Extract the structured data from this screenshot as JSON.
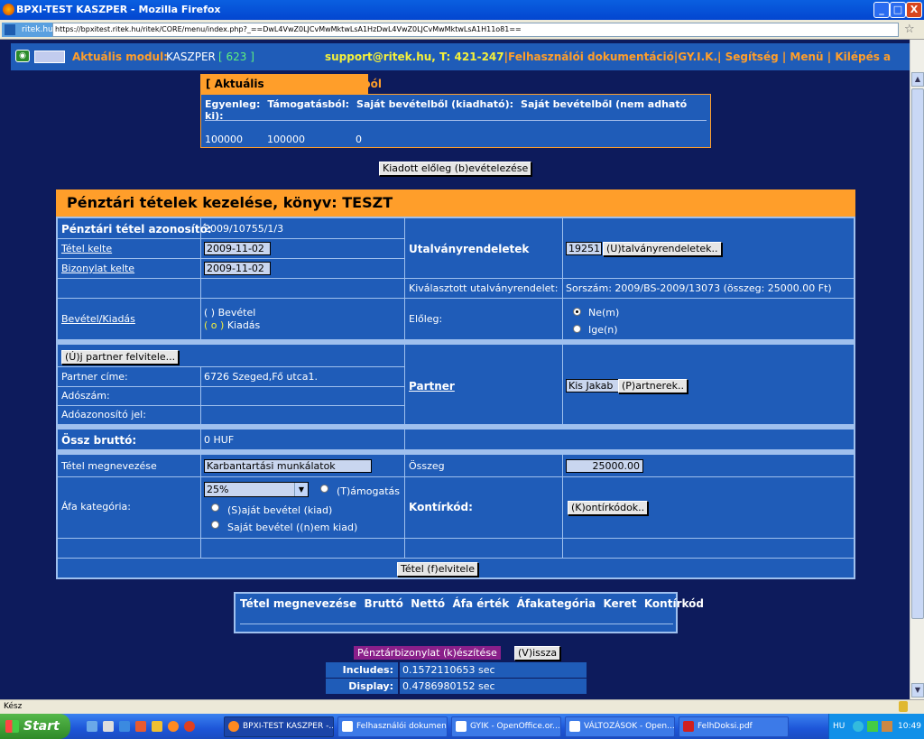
{
  "window": {
    "title": "BPXI-TEST KASZPER - Mozilla Firefox",
    "minimize": "_",
    "maximize": "□",
    "close": "X"
  },
  "urlbar": {
    "site": "ritek.hu",
    "url": "https://bpxitest.ritek.hu/ritek/CORE/menu/index.php?_==DwL4VwZ0LJCvMwMktwLsA1HzDwL4VwZ0LJCvMwMktwLsA1H11o81=="
  },
  "module": {
    "label": "Aktuális modul:",
    "name": "KASZPER",
    "number": "[ 623 ]",
    "links": [
      "support@ritek.hu, T: 421-247",
      "Felhasználói dokumentáció",
      "GY.I.K.",
      "Segítség",
      "Menü",
      "Kilépés a modulból"
    ]
  },
  "balance": {
    "title": "[ Aktuális pénztáregyenleg ]",
    "headers": [
      "Egyenleg:",
      "Támogatásból:",
      "Saját bevételből (kiadható):",
      "Saját bevételből (nem adható ki):"
    ],
    "values": [
      "100000",
      "100000",
      "0"
    ]
  },
  "advance_button": "Kiadott előleg (b)evételezése",
  "form": {
    "title": "Pénztári tételek kezelése, könyv: TESZT",
    "item_id_label": "Pénztári tétel azonosító:",
    "item_id": "2009/10755/1/3",
    "item_date_label": "Tétel kelte",
    "item_date": "2009-11-02",
    "doc_date_label": "Bizonylat kelte",
    "doc_date": "2009-11-02",
    "voucher_label": "Utalványrendeletek",
    "voucher_value": "19251",
    "voucher_button": "(U)talványrendeletek..",
    "selected_voucher_label": "Kiválasztott utalványrendelet:",
    "selected_voucher": "Sorszám: 2009/BS-2009/13073 (összeg: 25000.00 Ft)",
    "inout_label": "Bevétel/Kiadás",
    "income": "Bevétel",
    "expense": "Kiadás",
    "income_mark": "(   )",
    "expense_mark": "( o )",
    "advance_label": "Előleg:",
    "advance_no": "Ne(m)",
    "advance_yes": "Ige(n)",
    "new_partner_button": "(Ú)j partner felvitele...",
    "partner_addr_label": "Partner címe:",
    "partner_addr": "6726 Szeged,Fő utca1.",
    "tax_no_label": "Adószám:",
    "tax_id_label": "Adóazonosító jel:",
    "partner_label": "Partner",
    "partner_name": "Kis Jakab",
    "partner_button": "(P)artnerek..",
    "gross_label": "Össz bruttó:",
    "gross_value": "0 HUF",
    "item_name_label": "Tétel megnevezése",
    "item_name": "Karbantartási munkálatok",
    "amount_label": "Összeg",
    "amount": "25000.00",
    "vat_label": "Áfa kategória:",
    "vat_value": "25%",
    "support": "(T)ámogatás",
    "own_income": "(S)aját bevétel (kiad)",
    "own_income_no": "Saját bevétel ((n)em kiad)",
    "contir_label": "Kontírkód:",
    "contir_button": "(K)ontírkódok..",
    "submit_button": "Tétel (f)elvitele"
  },
  "summary": {
    "headers": [
      "Tétel megnevezése",
      "Bruttó",
      "Nettó",
      "Áfa érték",
      "Áfakategória",
      "Keret",
      "Kontírkód"
    ]
  },
  "print_button": "Pénztárbizonylat (k)észítése",
  "back_button": "(V)issza",
  "stats": [
    {
      "k": "Includes:",
      "v": "0.1572110653 sec"
    },
    {
      "k": "Display:",
      "v": "0.4786980152 sec"
    }
  ],
  "statusbar": "Kész",
  "taskbar": {
    "start": "Start",
    "tasks": [
      "BPXI-TEST KASZPER -...",
      "Felhasználói dokumen...",
      "GYIK - OpenOffice.or...",
      "VÁLTOZÁSOK - Open...",
      "FelhDoksi.pdf"
    ],
    "lang": "HU",
    "clock": "10:49"
  },
  "colors": {
    "accent": "#ff9e2a",
    "panel": "#1f5cb8",
    "background": "#0d1b5c",
    "link_yellow": "#f5f03a"
  }
}
